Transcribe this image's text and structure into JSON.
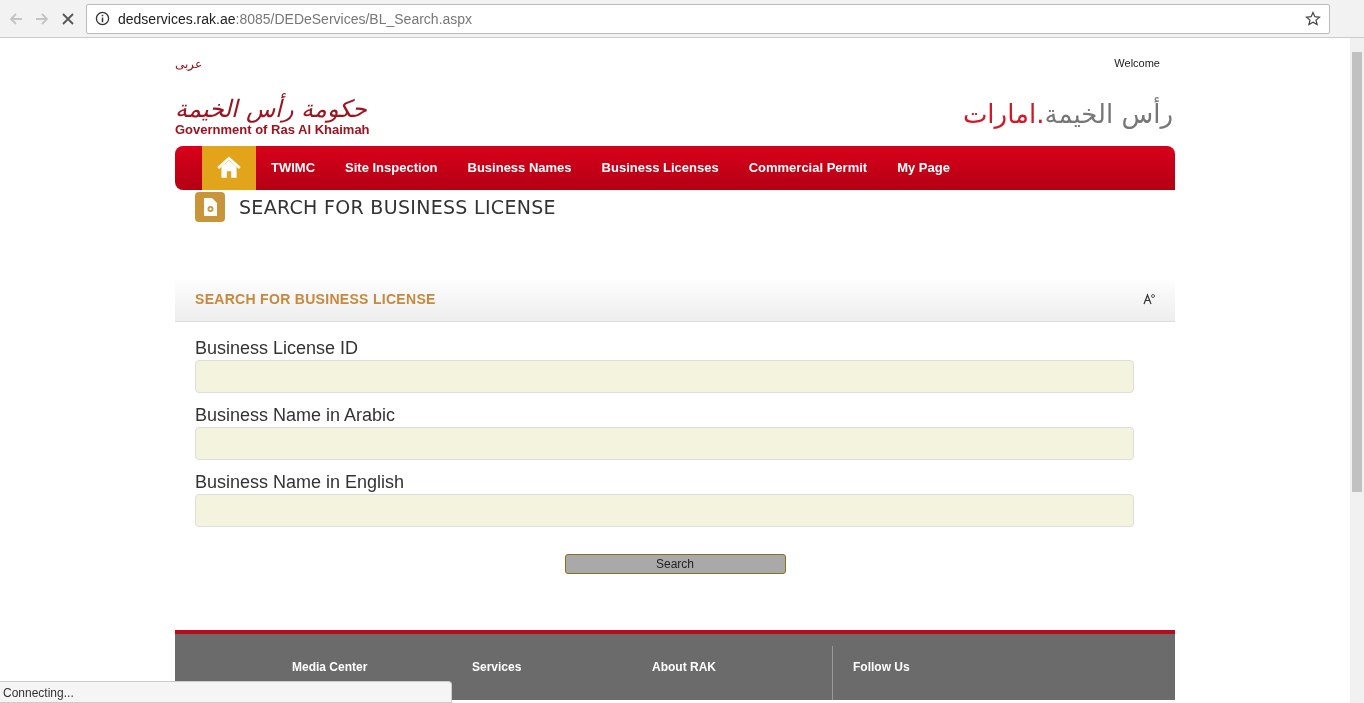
{
  "browser": {
    "host": "dedservices.rak.ae",
    "path": ":8085/DEDeServices/BL_Search.aspx",
    "loading": true,
    "status": "Connecting..."
  },
  "header": {
    "language_link": "عربى",
    "welcome": "Welcome",
    "gov_logo_arabic": "حكومة رأس الخيمة",
    "gov_logo_english": "Government of Ras Al Khaimah",
    "brand_logo_main": "رأس الخيمة",
    "brand_logo_accent": ".امارات"
  },
  "nav": {
    "home": {
      "selected": true
    },
    "items": [
      {
        "label": "TWIMC",
        "selected": false
      },
      {
        "label": "Site Inspection",
        "selected": false
      },
      {
        "label": "Business Names",
        "selected": false
      },
      {
        "label": "Business Licenses",
        "selected": false
      },
      {
        "label": "Commercial Permit",
        "selected": false
      },
      {
        "label": "My Page",
        "selected": false
      }
    ]
  },
  "page_title": "SEARCH FOR BUSINESS LICENSE",
  "panel": {
    "title": "SEARCH FOR BUSINESS LICENSE",
    "fields": [
      {
        "label": "Business License ID"
      },
      {
        "label": "Business Name in Arabic"
      },
      {
        "label": "Business Name in English"
      }
    ],
    "button": "Search"
  },
  "footer": {
    "columns": [
      "Media Center",
      "Services",
      "About RAK",
      "Follow Us"
    ]
  }
}
